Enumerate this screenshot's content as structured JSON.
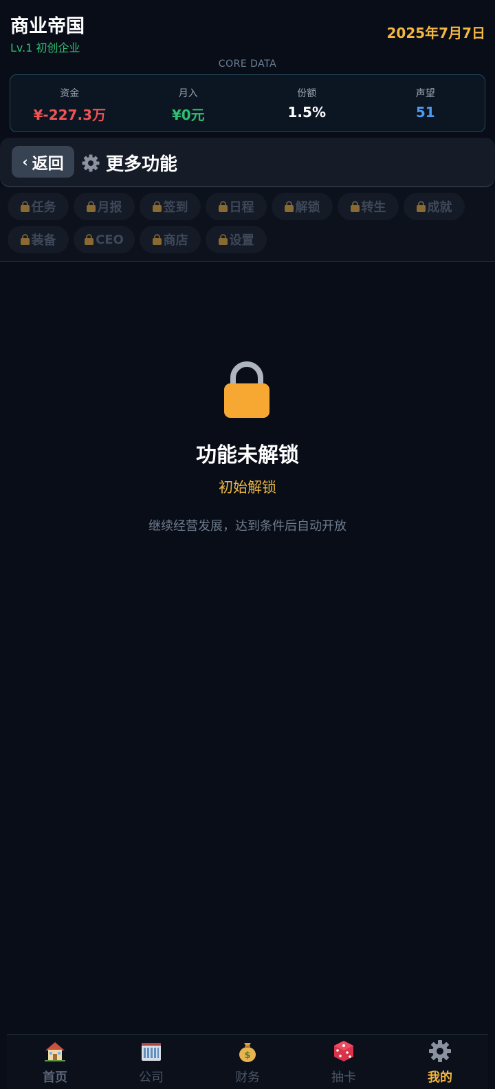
{
  "header": {
    "app_title": "商业帝国",
    "level": "Lv.1 初创企业",
    "date": "2025年7月7日",
    "core_label": "CORE DATA"
  },
  "stats": [
    {
      "label": "资金",
      "value": "¥-227.3万",
      "color": "#f05454"
    },
    {
      "label": "月入",
      "value": "¥0元",
      "color": "#2fbf71"
    },
    {
      "label": "份额",
      "value": "1.5%",
      "color": "#ffffff"
    },
    {
      "label": "声望",
      "value": "51",
      "color": "#4c9bf0"
    }
  ],
  "subheader": {
    "back_label": "返回",
    "back_chevron": "‹",
    "title": "更多功能",
    "title_icon": "gear-icon"
  },
  "feature_tabs": [
    {
      "label": "任务",
      "locked": true
    },
    {
      "label": "月报",
      "locked": true
    },
    {
      "label": "签到",
      "locked": true
    },
    {
      "label": "日程",
      "locked": true
    },
    {
      "label": "解锁",
      "locked": true
    },
    {
      "label": "转生",
      "locked": true
    },
    {
      "label": "成就",
      "locked": true
    },
    {
      "label": "装备",
      "locked": true
    },
    {
      "label": "CEO",
      "locked": true
    },
    {
      "label": "商店",
      "locked": true
    },
    {
      "label": "设置",
      "locked": true
    }
  ],
  "locked": {
    "icon": "lock-icon",
    "title": "功能未解锁",
    "condition": "初始解锁",
    "hint": "继续经营发展，达到条件后自动开放"
  },
  "bottom_nav": [
    {
      "label": "首页",
      "icon": "house-icon"
    },
    {
      "label": "公司",
      "icon": "office-building-icon"
    },
    {
      "label": "财务",
      "icon": "money-bag-icon"
    },
    {
      "label": "抽卡",
      "icon": "dice-icon"
    },
    {
      "label": "我的",
      "icon": "gear-icon",
      "active": true
    }
  ]
}
